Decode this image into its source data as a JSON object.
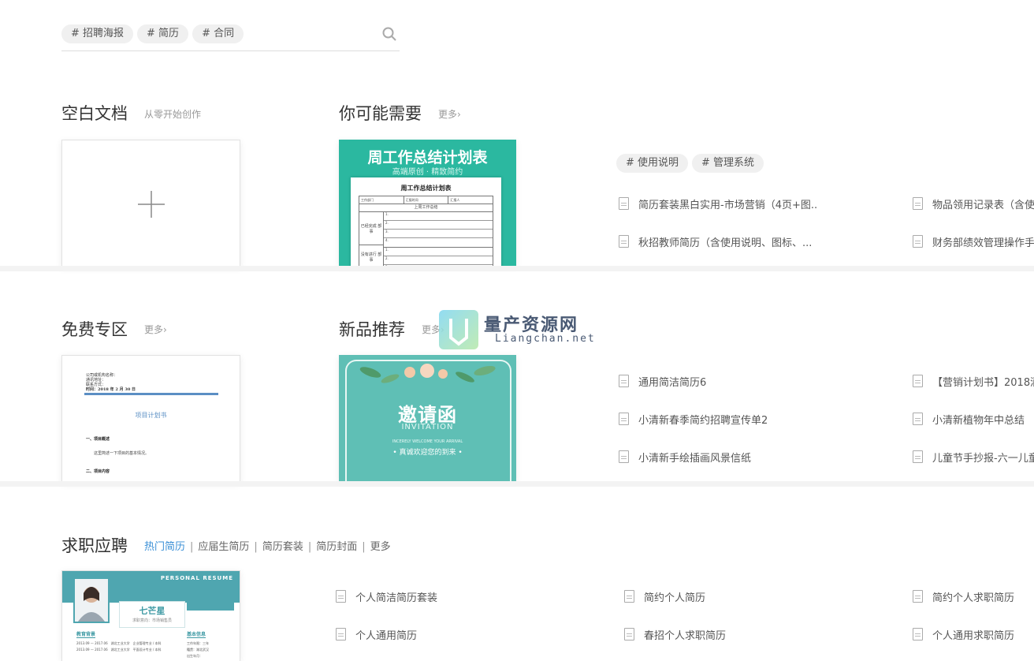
{
  "search": {
    "tags": [
      "# 招聘海报",
      "# 简历",
      "# 合同"
    ]
  },
  "blank": {
    "title": "空白文档",
    "sub": "从零开始创作",
    "plus": "+"
  },
  "need": {
    "title": "你可能需要",
    "more": "更多›",
    "thumb": {
      "title": "周工作总结计划表",
      "sub": "高端原创 · 精致简约",
      "doc_title": "周工作总结计划表",
      "row_head": [
        "工作部门",
        "汇报时间",
        "汇报人"
      ],
      "section": "上周工作总结",
      "left1": "已经完成 部事",
      "left2": "没有进行 部事",
      "nums": [
        "1.",
        "2.",
        "3.",
        "4.",
        "1.",
        "2.",
        "3."
      ]
    },
    "tags": [
      "# 使用说明",
      "# 管理系统"
    ],
    "files_col1": [
      "简历套装黑白实用-市场营销（4页+图..",
      "秋招教师简历（含使用说明、图标、..."
    ],
    "files_col2": [
      "物品领用记录表（含使",
      "财务部绩效管理操作手"
    ]
  },
  "free": {
    "title": "免费专区",
    "more": "更多›",
    "thumb": {
      "lines": [
        "公司或机构名称：",
        "通讯地址：",
        "联系方式："
      ],
      "date": "时间：2018 年 2 月 30 日",
      "doc_title": "项目计划书",
      "h1": "一、项目概述",
      "p1": "这里简述一下项目的基本情况。",
      "h2": "二、项目内容"
    }
  },
  "newp": {
    "title": "新品推荐",
    "more": "更多›",
    "thumb": {
      "title": "邀请函",
      "en": "INVITATION",
      "small": "INCERELY WELCOME YOUR ARRIVAL",
      "cn": "• 真诚欢迎您的到来 •"
    },
    "files_col1": [
      "通用简洁简历6",
      "小清新春季简约招聘宣传单2",
      "小清新手绘插画风景信纸"
    ],
    "files_col2": [
      "【营销计划书】2018酒",
      "小清新植物年中总结",
      "儿童节手抄报-六一儿童"
    ]
  },
  "watermark": {
    "cn": "量产资源网",
    "en": "Liangchan.net"
  },
  "job": {
    "title": "求职应聘",
    "tabs": [
      "热门简历",
      "应届生简历",
      "简历套装",
      "简历封面",
      "更多"
    ],
    "sep": "|",
    "thumb": {
      "header": "PERSONAL RESUME",
      "name": "七芒星",
      "intention": "求职意向：市场销售员",
      "edu": "教育背景",
      "basic": "基本信息",
      "edu_rows": [
        "2013.09 — 2017.06　湖北工业大学　企业管理专业 / 本科",
        "2013.09 — 2017.06　湖北工业大学　平面设计专业 / 本科"
      ],
      "info": [
        "工作年限：三年",
        "籍贯：湖北武汉",
        "出生年月："
      ]
    },
    "files_col1": [
      "个人简洁简历套装",
      "个人通用简历"
    ],
    "files_col2": [
      "简约个人简历",
      "春招个人求职简历"
    ],
    "files_col3": [
      "简约个人求职简历",
      "个人通用求职简历"
    ]
  },
  "colors": {
    "teal": "#2bb8a0",
    "invite": "#5fbfb5",
    "link": "#3a8fd6"
  }
}
